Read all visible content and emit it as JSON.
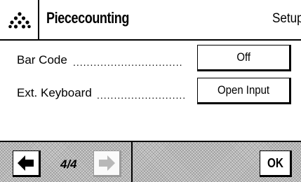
{
  "header": {
    "title": "Piececounting",
    "right_label": "Setup"
  },
  "settings": [
    {
      "label": "Bar Code",
      "dots": "................................",
      "value": "Off"
    },
    {
      "label": "Ext. Keyboard",
      "dots": "..........................",
      "value": "Open Input"
    }
  ],
  "footer": {
    "page_indicator": "4/4",
    "ok_label": "OK",
    "prev_icon": "arrow-left-icon",
    "next_icon": "arrow-right-icon"
  },
  "colors": {
    "disabled_arrow": "#b8b8b8",
    "footer_pattern": "#cfcfcf"
  }
}
